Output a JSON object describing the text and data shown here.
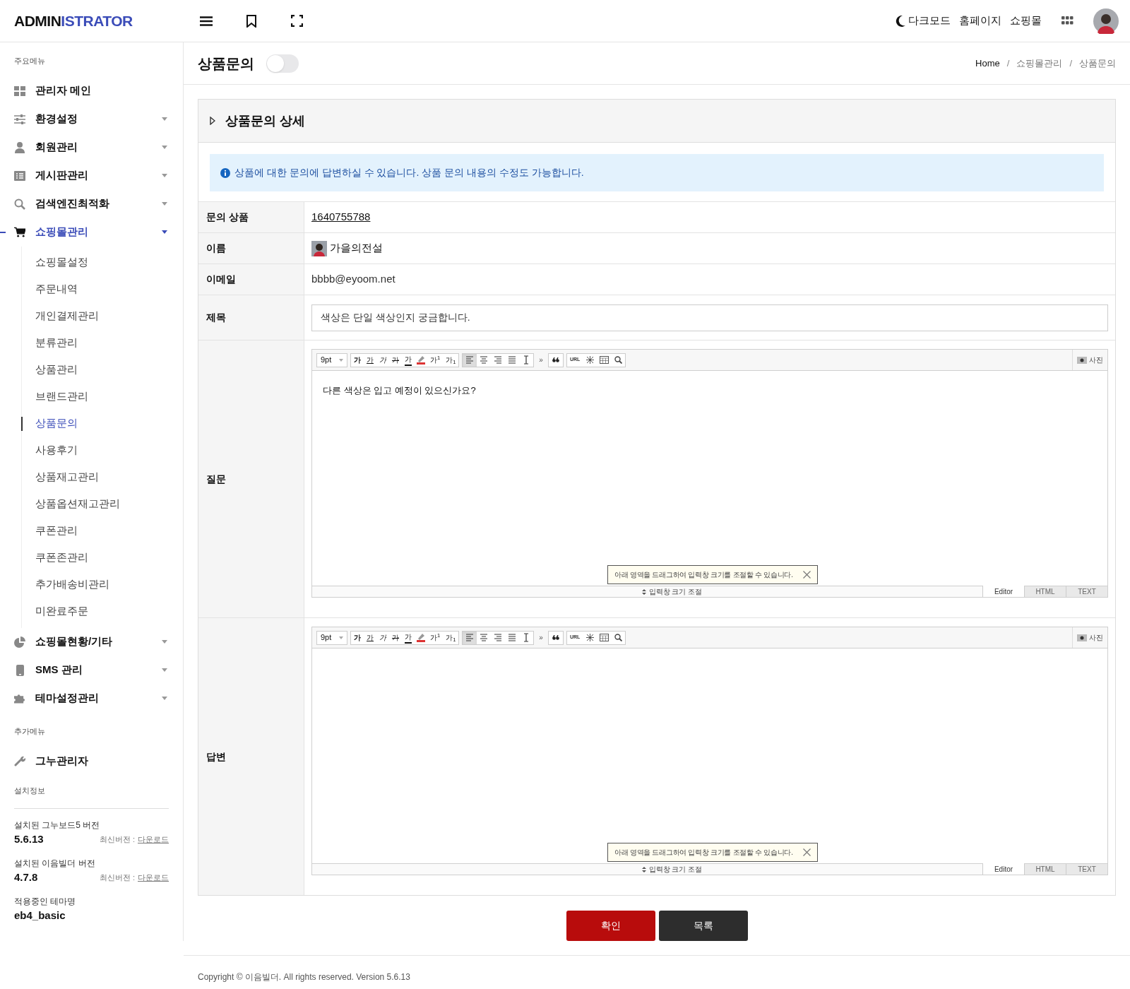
{
  "header": {
    "logo": {
      "part_1": "ADMIN",
      "part_2": "ISTRATOR"
    },
    "links": [
      {
        "label": "다크모드",
        "kind": "dark"
      },
      {
        "label": "홈페이지",
        "kind": "plain"
      },
      {
        "label": "쇼핑몰",
        "kind": "plain"
      }
    ]
  },
  "sidebar": {
    "main_label": "주요메뉴",
    "items": [
      {
        "label": "관리자 메인",
        "kind": "grid",
        "expandable": false,
        "expanded": false
      },
      {
        "label": "환경설정",
        "kind": "sliders",
        "expandable": true,
        "expanded": false
      },
      {
        "label": "회원관리",
        "kind": "user",
        "expandable": true,
        "expanded": false
      },
      {
        "label": "게시판관리",
        "kind": "list",
        "expandable": true,
        "expanded": false
      },
      {
        "label": "검색엔진최적화",
        "kind": "search",
        "expandable": true,
        "expanded": false
      },
      {
        "label": "쇼핑몰관리",
        "kind": "cart",
        "expandable": true,
        "expanded": true,
        "children": [
          {
            "label": "쇼핑몰설정",
            "selected": false
          },
          {
            "label": "주문내역",
            "selected": false
          },
          {
            "label": "개인결제관리",
            "selected": false
          },
          {
            "label": "분류관리",
            "selected": false
          },
          {
            "label": "상품관리",
            "selected": false
          },
          {
            "label": "브랜드관리",
            "selected": false
          },
          {
            "label": "상품문의",
            "selected": true
          },
          {
            "label": "사용후기",
            "selected": false
          },
          {
            "label": "상품재고관리",
            "selected": false
          },
          {
            "label": "상품옵션재고관리",
            "selected": false
          },
          {
            "label": "쿠폰관리",
            "selected": false
          },
          {
            "label": "쿠폰존관리",
            "selected": false
          },
          {
            "label": "추가배송비관리",
            "selected": false
          },
          {
            "label": "미완료주문",
            "selected": false
          }
        ]
      },
      {
        "label": "쇼핑몰현황/기타",
        "kind": "pie",
        "expandable": true,
        "expanded": false
      },
      {
        "label": "SMS 관리",
        "kind": "phone",
        "expandable": true,
        "expanded": false
      },
      {
        "label": "테마설정관리",
        "kind": "puzzle",
        "expandable": true,
        "expanded": false
      }
    ],
    "extra_label": "추가메뉴",
    "extra_items": [
      {
        "label": "그누관리자",
        "kind": "wrench"
      }
    ],
    "install_label": "설치정보",
    "install": [
      {
        "label": "설치된 그누보드5 버전",
        "value": "5.6.13",
        "latest_label": "최신버전 :",
        "latest_link": "다운로드"
      },
      {
        "label": "설치된 이음빌더 버전",
        "value": "4.7.8",
        "latest_label": "최신버전 :",
        "latest_link": "다운로드"
      },
      {
        "label": "적용중인 테마명",
        "value": "eb4_basic"
      }
    ]
  },
  "page": {
    "title": "상품문의",
    "toggle_on": false,
    "breadcrumb": [
      "Home",
      "쇼핑몰관리",
      "상품문의"
    ],
    "breadcrumb_separator": "/"
  },
  "panel": {
    "title": "상품문의 상세",
    "expanded": false,
    "notice": "상품에 대한 문의에 답변하실 수 있습니다. 상품 문의 내용의 수정도 가능합니다.",
    "rows": [
      {
        "label": "문의 상품",
        "kind": "link",
        "value": "1640755788"
      },
      {
        "label": "이름",
        "kind": "user",
        "value": "가을의전설"
      },
      {
        "label": "이메일",
        "kind": "text",
        "value": "bbbb@eyoom.net"
      },
      {
        "label": "제목",
        "kind": "input",
        "value": "색상은 단일 색상인지 궁금합니다."
      },
      {
        "label": "질문",
        "kind": "editor",
        "editor": {
          "font_size": "9pt",
          "format_buttons": [
            {
              "label": "가",
              "kind": "bold"
            },
            {
              "label": "가",
              "kind": "underline"
            },
            {
              "label": "가",
              "kind": "italic"
            },
            {
              "label": "가",
              "kind": "strike"
            },
            {
              "label": "가",
              "kind": "color"
            },
            {
              "label": "가$^{1}$",
              "kind": "plain"
            },
            {
              "label": "가$_{1}$",
              "kind": "plain"
            }
          ],
          "align_buttons": [
            {
              "selected": true
            },
            {
              "selected": false
            },
            {
              "selected": false
            },
            {
              "selected": false
            },
            {
              "selected": false
            }
          ],
          "more": "»",
          "url": "URL",
          "photo": "사진",
          "content": "다른 색상은 입고 예정이 있으신가요?",
          "tooltip": "아래 영역을 드래그하여 입력창 크기를 조절할 수 있습니다.",
          "resize": "입력창 크기 조절",
          "modes": [
            {
              "label": "Editor",
              "selected": true
            },
            {
              "label": "HTML",
              "selected": false
            },
            {
              "label": "TEXT",
              "selected": false
            }
          ]
        }
      },
      {
        "label": "답변",
        "kind": "editor",
        "editor": {
          "font_size": "9pt",
          "format_buttons": [
            {
              "label": "가",
              "kind": "bold"
            },
            {
              "label": "가",
              "kind": "underline"
            },
            {
              "label": "가",
              "kind": "italic"
            },
            {
              "label": "가",
              "kind": "strike"
            },
            {
              "label": "가",
              "kind": "color"
            },
            {
              "label": "가$^{1}$",
              "kind": "plain"
            },
            {
              "label": "가$_{1}$",
              "kind": "plain"
            }
          ],
          "align_buttons": [
            {
              "selected": true
            },
            {
              "selected": false
            },
            {
              "selected": false
            },
            {
              "selected": false
            },
            {
              "selected": false
            }
          ],
          "more": "»",
          "url": "URL",
          "photo": "사진",
          "tooltip": "아래 영역을 드래그하여 입력창 크기를 조절할 수 있습니다.",
          "resize": "입력창 크기 조절",
          "modes": [
            {
              "label": "Editor",
              "selected": true
            },
            {
              "label": "HTML",
              "selected": false
            },
            {
              "label": "TEXT",
              "selected": false
            }
          ]
        }
      }
    ]
  },
  "buttons": [
    {
      "label": "확인",
      "kind": "primary"
    },
    {
      "label": "목록",
      "kind": "secondary"
    }
  ],
  "footer": "Copyright © 이음빌더. All rights reserved. Version 5.6.13"
}
